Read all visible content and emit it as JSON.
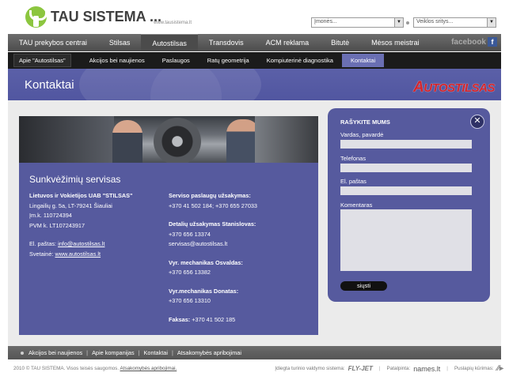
{
  "header": {
    "logo_text": "TAU SISTEMA ...",
    "site_url": "www.tausistema.lt",
    "select_companies": "Įmonės...",
    "select_activities": "Veiklos sritys..."
  },
  "main_nav": {
    "items": [
      {
        "label": "TAU prekybos centrai"
      },
      {
        "label": "Stilsas"
      },
      {
        "label": "Autostilsas"
      },
      {
        "label": "Transdovis"
      },
      {
        "label": "ACM reklama"
      },
      {
        "label": "Bitutė"
      },
      {
        "label": "Mėsos meistrai"
      }
    ],
    "active_index": 2,
    "facebook": "facebook",
    "facebook_box": "f"
  },
  "sub_nav": {
    "items": [
      {
        "label": "Apie \"Autostilsas\""
      },
      {
        "label": "Akcijos bei naujienos"
      },
      {
        "label": "Paslaugos"
      },
      {
        "label": "Ratų geometrija"
      },
      {
        "label": "Kompiuterinė diagnostika"
      },
      {
        "label": "Kontaktai"
      }
    ],
    "active_index": 5
  },
  "banner": {
    "title": "Kontaktai",
    "brand_logo_first": "A",
    "brand_logo_rest": "UTOSTILSAS"
  },
  "service": {
    "title": "Sunkvėžimių servisas",
    "company_name": "Lietuvos ir Vokietijos UAB \"STILSAS\"",
    "address": "Lingailių g. 5a, LT-79241 Šiauliai",
    "company_code": "Įm.k. 110724394",
    "vat_code": "PVM k. LT107243917",
    "email_label": "El. paštas:",
    "email_value": "info@autostilsas.lt",
    "website_label": "Svetainė:",
    "website_value": "www.autostilsas.lt",
    "booking_label": "Serviso paslaugų užsakymas:",
    "booking_phones": "+370 41 502 184; +370 655 27033",
    "parts_label": "Detalių užsakymas Stanislovas:",
    "parts_phone": "+370 656 13374",
    "parts_email": "servisas@autostilsas.lt",
    "mech1_label": "Vyr. mechanikas Osvaldas:",
    "mech1_phone": "+370 656 13382",
    "mech2_label": "Vyr.mechanikas Donatas:",
    "mech2_phone": "+370 656 13310",
    "fax_label": "Faksas:",
    "fax_value": "+370 41 502 185"
  },
  "form": {
    "title": "RAŠYKITE MUMS",
    "close_glyph": "✕",
    "name_label": "Vardas, pavardė",
    "phone_label": "Telefonas",
    "email_label": "El. paštas",
    "comment_label": "Komentaras",
    "submit_label": "siųsti"
  },
  "footer_nav": {
    "links": [
      "Akcijos bei naujienos",
      "Apie kompanijas",
      "Kontaktai",
      "Atsakomybės apribojimai"
    ],
    "separator": "|"
  },
  "bottom_bar": {
    "copyright": "2010 © TAU SISTEMA. Visos teisės saugomos.",
    "disclaimer": "Atsakomybės apribojimai.",
    "cms_label": "Įdiegta turinio valdymo sistema:",
    "cms_logo": "FLY-JET",
    "host_label": "Patalpinta:",
    "host_logo": "names.lt",
    "design_label": "Puslapių kūrimas:",
    "design_logo": "⁄⁄▸"
  }
}
